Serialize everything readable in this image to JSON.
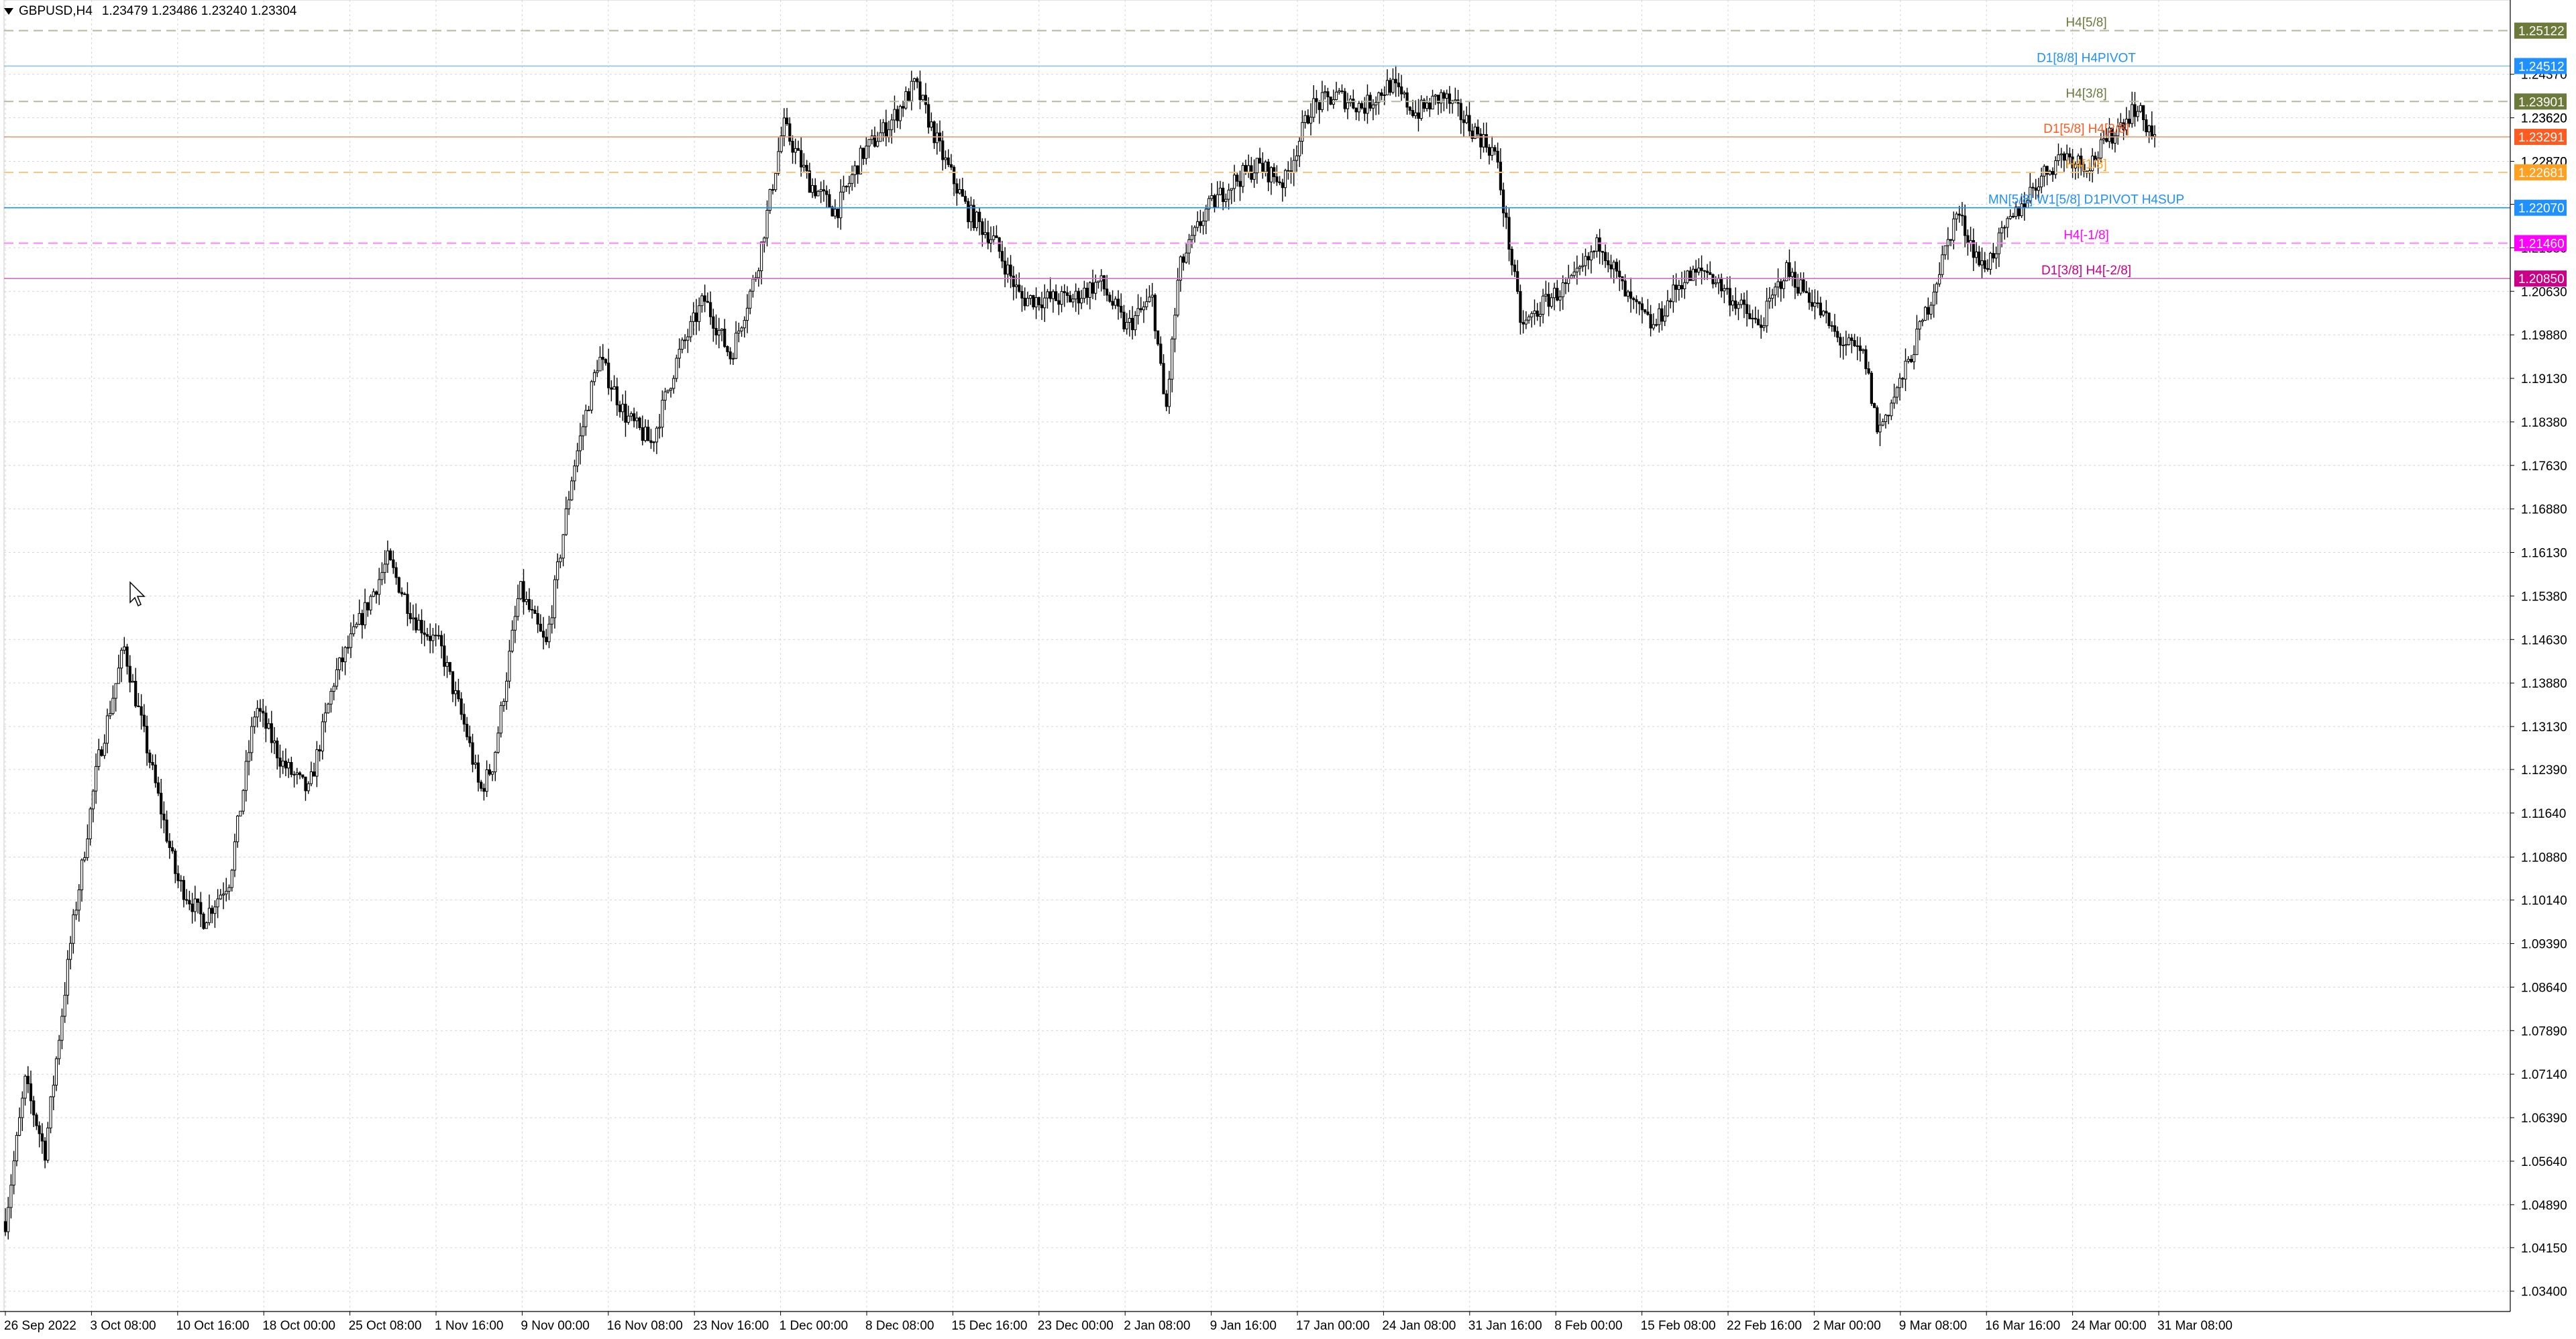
{
  "header": {
    "symbol": "GBPUSD,H4",
    "ohlc": "1.23479 1.23486 1.23240 1.23304"
  },
  "chart_data": {
    "type": "candlestick",
    "symbol": "GBPUSD",
    "timeframe": "H4",
    "grid": true,
    "ylim": [
      1.0305,
      1.2565
    ],
    "price_ticks": [
      "1.03400",
      "1.04150",
      "1.04890",
      "1.05640",
      "1.06390",
      "1.07140",
      "1.07890",
      "1.08640",
      "1.09390",
      "1.10140",
      "1.10880",
      "1.11640",
      "1.12390",
      "1.13130",
      "1.13880",
      "1.14630",
      "1.15380",
      "1.16130",
      "1.16880",
      "1.17630",
      "1.18380",
      "1.19130",
      "1.19880",
      "1.20630",
      "1.21380",
      "1.22130",
      "1.22870",
      "1.23620",
      "1.24370"
    ],
    "time_ticks": [
      "26 Sep 2022",
      "3 Oct 08:00",
      "10 Oct 16:00",
      "18 Oct 00:00",
      "25 Oct 08:00",
      "1 Nov 16:00",
      "9 Nov 00:00",
      "16 Nov 08:00",
      "23 Nov 16:00",
      "1 Dec 00:00",
      "8 Dec 08:00",
      "15 Dec 16:00",
      "23 Dec 00:00",
      "2 Jan 08:00",
      "9 Jan 16:00",
      "17 Jan 00:00",
      "24 Jan 08:00",
      "31 Jan 16:00",
      "8 Feb 00:00",
      "15 Feb 08:00",
      "22 Feb 16:00",
      "2 Mar 00:00",
      "9 Mar 08:00",
      "16 Mar 16:00",
      "24 Mar 00:00",
      "31 Mar 08:00"
    ],
    "path_keypoints": [
      [
        0,
        1.046
      ],
      [
        3,
        1.07
      ],
      [
        6,
        1.058
      ],
      [
        10,
        1.095
      ],
      [
        14,
        1.125
      ],
      [
        18,
        1.145
      ],
      [
        22,
        1.125
      ],
      [
        26,
        1.105
      ],
      [
        30,
        1.098
      ],
      [
        34,
        1.105
      ],
      [
        38,
        1.135
      ],
      [
        42,
        1.125
      ],
      [
        46,
        1.12
      ],
      [
        50,
        1.14
      ],
      [
        54,
        1.15
      ],
      [
        58,
        1.16
      ],
      [
        62,
        1.15
      ],
      [
        66,
        1.145
      ],
      [
        70,
        1.13
      ],
      [
        72,
        1.12
      ],
      [
        74,
        1.125
      ],
      [
        78,
        1.155
      ],
      [
        82,
        1.145
      ],
      [
        86,
        1.175
      ],
      [
        90,
        1.195
      ],
      [
        94,
        1.185
      ],
      [
        98,
        1.18
      ],
      [
        102,
        1.195
      ],
      [
        106,
        1.205
      ],
      [
        110,
        1.195
      ],
      [
        114,
        1.21
      ],
      [
        118,
        1.235
      ],
      [
        122,
        1.225
      ],
      [
        126,
        1.22
      ],
      [
        130,
        1.23
      ],
      [
        134,
        1.235
      ],
      [
        138,
        1.242
      ],
      [
        142,
        1.23
      ],
      [
        146,
        1.22
      ],
      [
        150,
        1.215
      ],
      [
        154,
        1.205
      ],
      [
        158,
        1.205
      ],
      [
        162,
        1.205
      ],
      [
        166,
        1.208
      ],
      [
        170,
        1.2
      ],
      [
        174,
        1.205
      ],
      [
        176,
        1.185
      ],
      [
        178,
        1.21
      ],
      [
        182,
        1.22
      ],
      [
        186,
        1.225
      ],
      [
        190,
        1.228
      ],
      [
        194,
        1.225
      ],
      [
        198,
        1.238
      ],
      [
        202,
        1.24
      ],
      [
        206,
        1.238
      ],
      [
        210,
        1.242
      ],
      [
        214,
        1.237
      ],
      [
        218,
        1.24
      ],
      [
        222,
        1.235
      ],
      [
        226,
        1.23
      ],
      [
        230,
        1.2
      ],
      [
        234,
        1.205
      ],
      [
        238,
        1.208
      ],
      [
        242,
        1.215
      ],
      [
        246,
        1.205
      ],
      [
        250,
        1.2
      ],
      [
        254,
        1.208
      ],
      [
        258,
        1.21
      ],
      [
        262,
        1.205
      ],
      [
        266,
        1.2
      ],
      [
        270,
        1.21
      ],
      [
        274,
        1.205
      ],
      [
        278,
        1.198
      ],
      [
        282,
        1.195
      ],
      [
        284,
        1.182
      ],
      [
        288,
        1.192
      ],
      [
        292,
        1.205
      ],
      [
        296,
        1.22
      ],
      [
        300,
        1.21
      ],
      [
        304,
        1.218
      ],
      [
        308,
        1.225
      ],
      [
        312,
        1.23
      ],
      [
        316,
        1.228
      ],
      [
        320,
        1.234
      ],
      [
        323,
        1.238
      ],
      [
        326,
        1.233
      ]
    ],
    "levels": [
      {
        "label": "H4[5/8]",
        "price": 1.25122,
        "price_label": "1.25122",
        "color": "#6b7a3a",
        "line": "#b8b8a0",
        "dash": true
      },
      {
        "label": "D1[8/8] H4PIVOT",
        "price": 1.24512,
        "price_label": "1.24512",
        "color": "#1e90ff",
        "line": "#8cc4f0",
        "dash": false
      },
      {
        "label": "H4[3/8]",
        "price": 1.23901,
        "price_label": "1.23901",
        "color": "#6b7a3a",
        "line": "#b8b8a0",
        "dash": true
      },
      {
        "label": "D1[5/8] H4[2/8]",
        "price": 1.23291,
        "price_label": "1.23291",
        "color": "#ff5a1f",
        "line": "#e8a070",
        "dash": false
      },
      {
        "label": "H4[1/8]",
        "price": 1.22681,
        "price_label": "1.22681",
        "color": "#ffa020",
        "line": "#f4c680",
        "dash": true
      },
      {
        "label": "MN[5/8] W1[5/8] D1PIVOT H4SUP",
        "price": 1.2207,
        "price_label": "1.22070",
        "color": "#1e90ff",
        "line": "#1e90ff",
        "dash": false
      },
      {
        "label": "H4[-1/8]",
        "price": 1.2146,
        "price_label": "1.21460",
        "color": "#ff00ff",
        "line": "#ff80ff",
        "dash": true
      },
      {
        "label": "D1[3/8] H4[-2/8]",
        "price": 1.2085,
        "price_label": "1.20850",
        "color": "#cc0088",
        "line": "#d070c0",
        "dash": false
      }
    ],
    "current_price": {
      "price": 1.2362,
      "label": "1.23620",
      "color": "#000000"
    },
    "extra_ticks": [
      {
        "price": 1.2287,
        "label": "1.22870"
      },
      {
        "price": 1.2213,
        "label": "1.22130"
      }
    ]
  }
}
